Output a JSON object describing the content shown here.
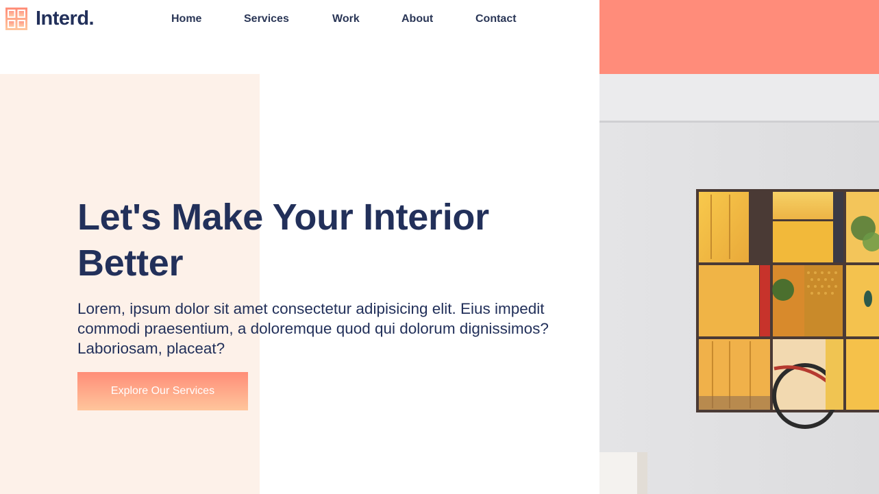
{
  "brand": {
    "name": "Interd."
  },
  "nav": {
    "items": [
      {
        "label": "Home"
      },
      {
        "label": "Services"
      },
      {
        "label": "Work"
      },
      {
        "label": "About"
      },
      {
        "label": "Contact"
      }
    ]
  },
  "hero": {
    "title": "Let's Make Your Interior Better",
    "description": "Lorem, ipsum dolor sit amet consectetur adipisicing elit. Eius impedit commodi praesentium, a doloremque quod qui dolorum dignissimos? Laboriosam, placeat?",
    "cta_label": "Explore Our Services"
  },
  "colors": {
    "navy": "#22305a",
    "salmon": "#ff8c7a",
    "peach": "#fdf1e9",
    "cta_gradient_top": "#ff8d78",
    "cta_gradient_bottom": "#ffc59c"
  },
  "icons": {
    "logo": "grid-four-squares-icon"
  },
  "image": {
    "subject": "wall-art-photo"
  }
}
